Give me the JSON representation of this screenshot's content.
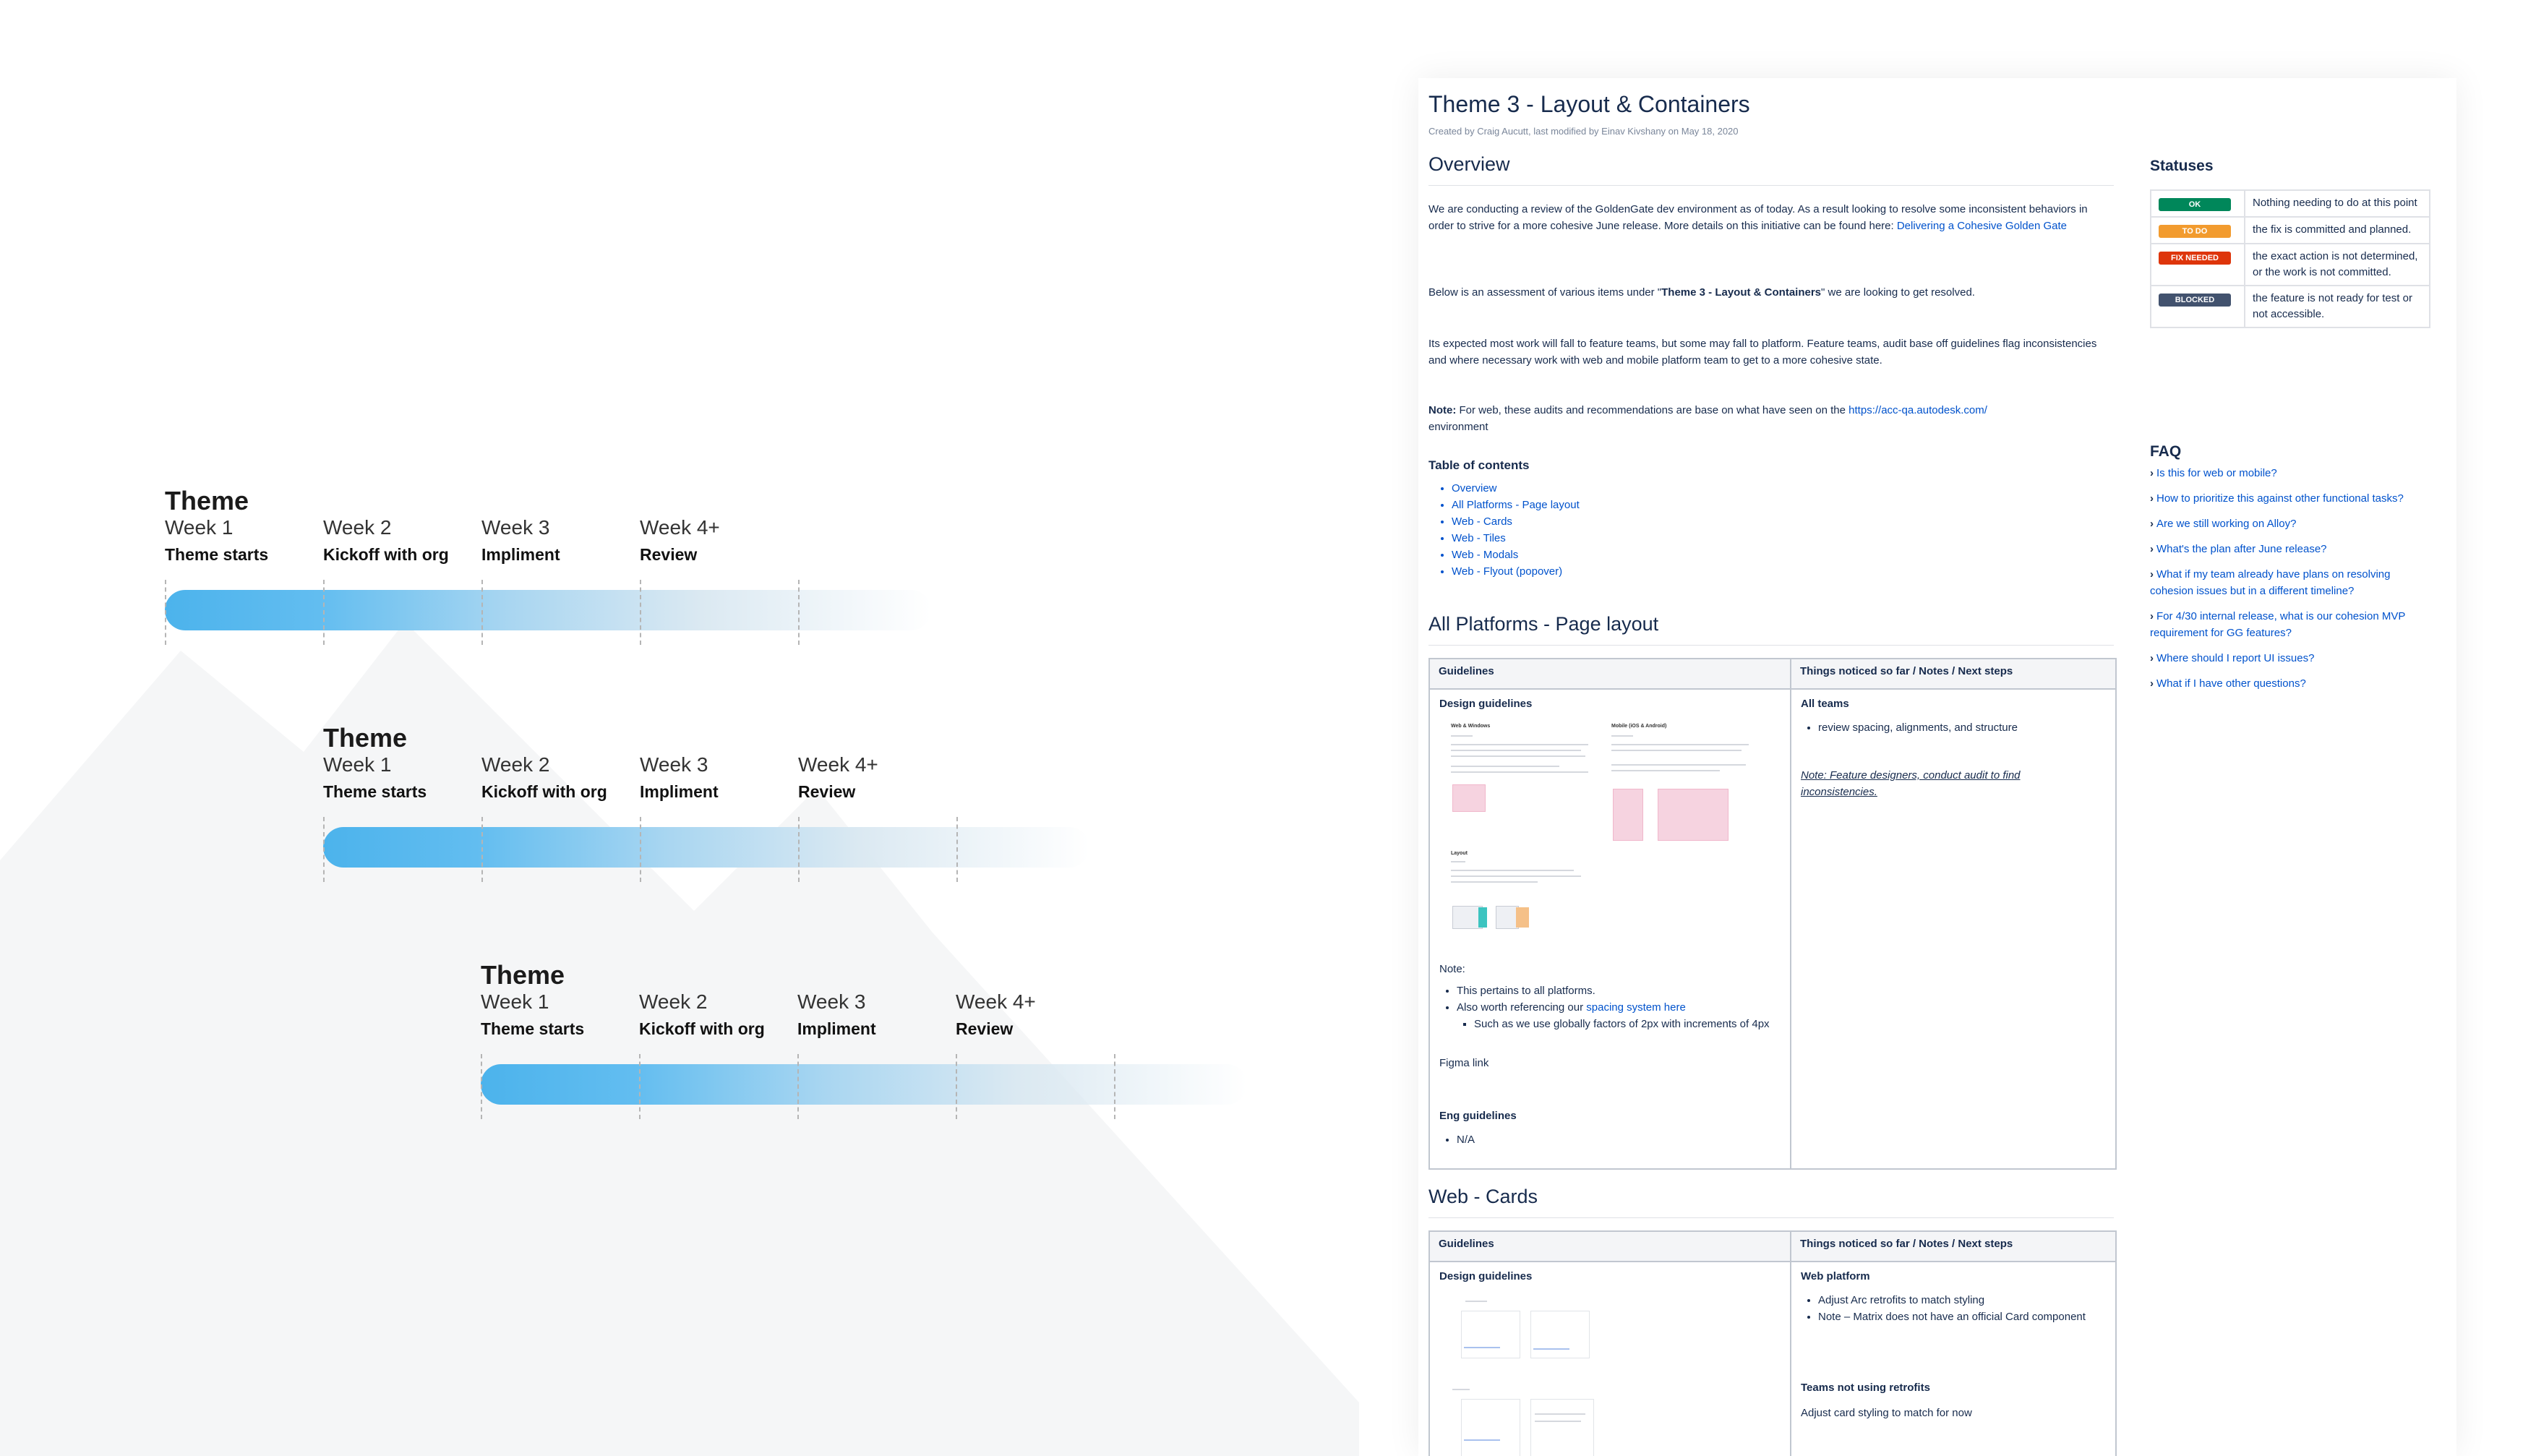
{
  "colors": {
    "bar_start": "#4cb3ec",
    "link": "#0052cc",
    "status_ok": "#00875a",
    "status_todo": "#f29b2e",
    "status_fix": "#de350b",
    "status_blocked": "#42526e"
  },
  "timelines": [
    {
      "theme": "Theme",
      "weeks": [
        {
          "label": "Week 1",
          "desc": "Theme starts"
        },
        {
          "label": "Week 2",
          "desc": "Kickoff with org"
        },
        {
          "label": "Week 3",
          "desc": "Impliment"
        },
        {
          "label": "Week 4+",
          "desc": "Review"
        }
      ]
    },
    {
      "theme": "Theme",
      "weeks": [
        {
          "label": "Week 1",
          "desc": "Theme starts"
        },
        {
          "label": "Week 2",
          "desc": "Kickoff with org"
        },
        {
          "label": "Week 3",
          "desc": "Impliment"
        },
        {
          "label": "Week 4+",
          "desc": "Review"
        }
      ]
    },
    {
      "theme": "Theme",
      "weeks": [
        {
          "label": "Week 1",
          "desc": "Theme starts"
        },
        {
          "label": "Week 2",
          "desc": "Kickoff with org"
        },
        {
          "label": "Week 3",
          "desc": "Impliment"
        },
        {
          "label": "Week 4+",
          "desc": "Review"
        }
      ]
    }
  ],
  "doc": {
    "title": "Theme 3 - Layout & Containers",
    "byline": "Created by Craig Aucutt, last modified by Einav Kivshany on May 18, 2020",
    "overview_heading": "Overview",
    "overview_p1": "We are conducting a review of the GoldenGate dev environment as of today. As a result looking to resolve some inconsistent behaviors in order to strive for a more cohesive June release. More details on this initiative can be found here: ",
    "overview_p1_link": "Delivering a Cohesive Golden Gate",
    "overview_p2_a": "Below is an assessment of various items under \"",
    "overview_p2_b": "Theme 3 - Layout & Containers",
    "overview_p2_c": "\" we are looking to get resolved.",
    "overview_p3": "Its expected most work will fall to feature teams, but some may fall to platform. Feature teams, audit base off guidelines flag inconsistencies and where necessary work with web and mobile platform team to get to a more cohesive state.",
    "note_label": "Note:",
    "note_text": " For web, these audits and recommendations are base on what have seen on the ",
    "note_link": "https://acc-qa.autodesk.com/",
    "note_tail": " environment",
    "toc_title": "Table of contents",
    "toc": [
      "Overview",
      "All Platforms - Page layout",
      "Web - Cards",
      "Web - Tiles",
      "Web - Modals",
      "Web - Flyout (popover)"
    ],
    "section1": {
      "heading": "All Platforms - Page layout",
      "col1": "Guidelines",
      "col2": "Things noticed so far / Notes / Next steps",
      "design_label": "Design guidelines",
      "thumb_web": "Web & Windows",
      "thumb_mobile": "Mobile (iOS & Android)",
      "thumb_layout": "Layout",
      "note_label": "Note:",
      "bullet1": "This pertains to all platforms.",
      "bullet2_a": "Also worth referencing our ",
      "bullet2_link": "spacing system here",
      "sub_bullet": "Such as we use globally factors of 2px with increments of 4px",
      "figma": "Figma link",
      "eng_label": "Eng guidelines",
      "eng_bullet": "N/A",
      "teams_label": "All teams",
      "teams_bullet": "review spacing, alignments, and structure",
      "teams_note": "Note: Feature designers, conduct audit to find inconsistencies."
    },
    "section2": {
      "heading": "Web - Cards",
      "col1": "Guidelines",
      "col2": "Things noticed so far / Notes / Next steps",
      "design_label": "Design guidelines",
      "platform_label": "Web platform",
      "platform_b1": "Adjust Arc retrofits to match styling",
      "platform_b2": "Note – Matrix does not have an official Card component",
      "no_retro_label": "Teams not using retrofits",
      "no_retro_text": "Adjust card styling to match for now"
    }
  },
  "sidebar": {
    "statuses_heading": "Statuses",
    "statuses": [
      {
        "badge": "OK",
        "color": "#00875a",
        "text": "Nothing needing to do at this point"
      },
      {
        "badge": "TO DO",
        "color": "#f29b2e",
        "text": "the fix is committed and planned."
      },
      {
        "badge": "FIX NEEDED",
        "color": "#de350b",
        "text": "the exact action is not determined, or the work is not committed."
      },
      {
        "badge": "BLOCKED",
        "color": "#42526e",
        "text": "the feature is not ready for test or not accessible."
      }
    ],
    "faq_heading": "FAQ",
    "faq": [
      "Is this for web or mobile?",
      "How to prioritize this against other functional tasks?",
      "Are we still working on Alloy?",
      "What's the plan after June release?",
      "What if my team already have plans on resolving cohesion issues but in a different timeline?",
      "For 4/30 internal release, what is our cohesion MVP requirement for GG features?",
      "Where should I report UI issues?",
      "What if I have other questions?"
    ]
  }
}
